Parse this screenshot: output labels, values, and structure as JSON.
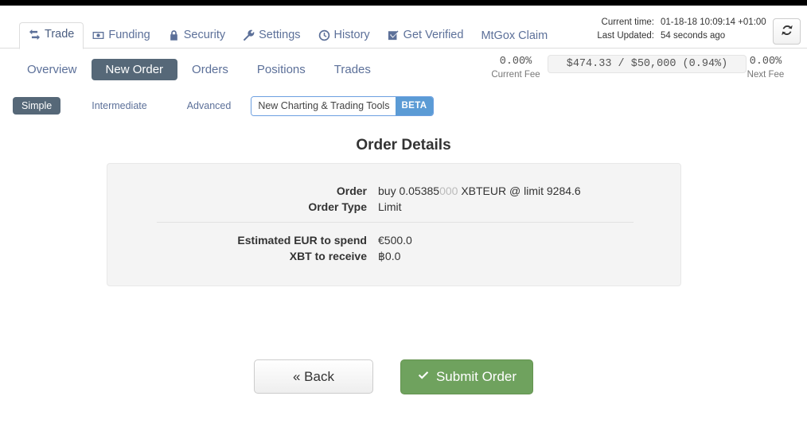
{
  "header": {
    "tabs": [
      {
        "label": "Trade",
        "icon": "exchange-icon",
        "active": true
      },
      {
        "label": "Funding",
        "icon": "banknote-icon",
        "active": false
      },
      {
        "label": "Security",
        "icon": "lock-icon",
        "active": false
      },
      {
        "label": "Settings",
        "icon": "wrench-icon",
        "active": false
      },
      {
        "label": "History",
        "icon": "clock-icon",
        "active": false
      },
      {
        "label": "Get Verified",
        "icon": "checkbox-icon",
        "active": false
      },
      {
        "label": "MtGox Claim",
        "icon": "",
        "active": false
      }
    ],
    "status": {
      "current_time_label": "Current time:",
      "current_time_value": "01-18-18 10:09:14 +01:00",
      "last_updated_label": "Last Updated:",
      "last_updated_value": "54 seconds ago",
      "refresh_icon": "refresh-icon"
    }
  },
  "subnav": {
    "items": [
      {
        "label": "Overview",
        "active": false
      },
      {
        "label": "New Order",
        "active": true
      },
      {
        "label": "Orders",
        "active": false
      },
      {
        "label": "Positions",
        "active": false
      },
      {
        "label": "Trades",
        "active": false
      }
    ]
  },
  "fees": {
    "current": {
      "value": "0.00%",
      "caption": "Current Fee"
    },
    "volume": "$474.33 / $50,000 (0.94%)",
    "next": {
      "value": "0.00%",
      "caption": "Next Fee"
    }
  },
  "modes": {
    "items": [
      {
        "label": "Simple",
        "active": true
      },
      {
        "label": "Intermediate",
        "active": false
      },
      {
        "label": "Advanced",
        "active": false
      }
    ],
    "promo": {
      "label": "New Charting & Trading Tools",
      "badge": "BETA"
    }
  },
  "main": {
    "title": "Order Details",
    "rows_group1": [
      {
        "label": "Order",
        "value_prefix": "buy 0.05385",
        "value_muted": "000",
        "value_suffix": " XBTEUR @ limit 9284.6"
      },
      {
        "label": "Order Type",
        "value_prefix": "Limit",
        "value_muted": "",
        "value_suffix": ""
      }
    ],
    "rows_group2": [
      {
        "label": "Estimated EUR to spend",
        "value_prefix": "€500.0",
        "value_muted": "",
        "value_suffix": ""
      },
      {
        "label": "XBT to receive",
        "value_prefix": "฿0.0",
        "value_muted": "",
        "value_suffix": ""
      }
    ],
    "back_button": "« Back",
    "submit_button": "Submit Order",
    "submit_icon": "check-icon"
  },
  "colors": {
    "accent_link": "#5c7099",
    "active_pill": "#566878",
    "submit_green": "#6fa25e",
    "beta_blue": "#5b9bd5",
    "panel_bg": "#f4f4f4"
  }
}
